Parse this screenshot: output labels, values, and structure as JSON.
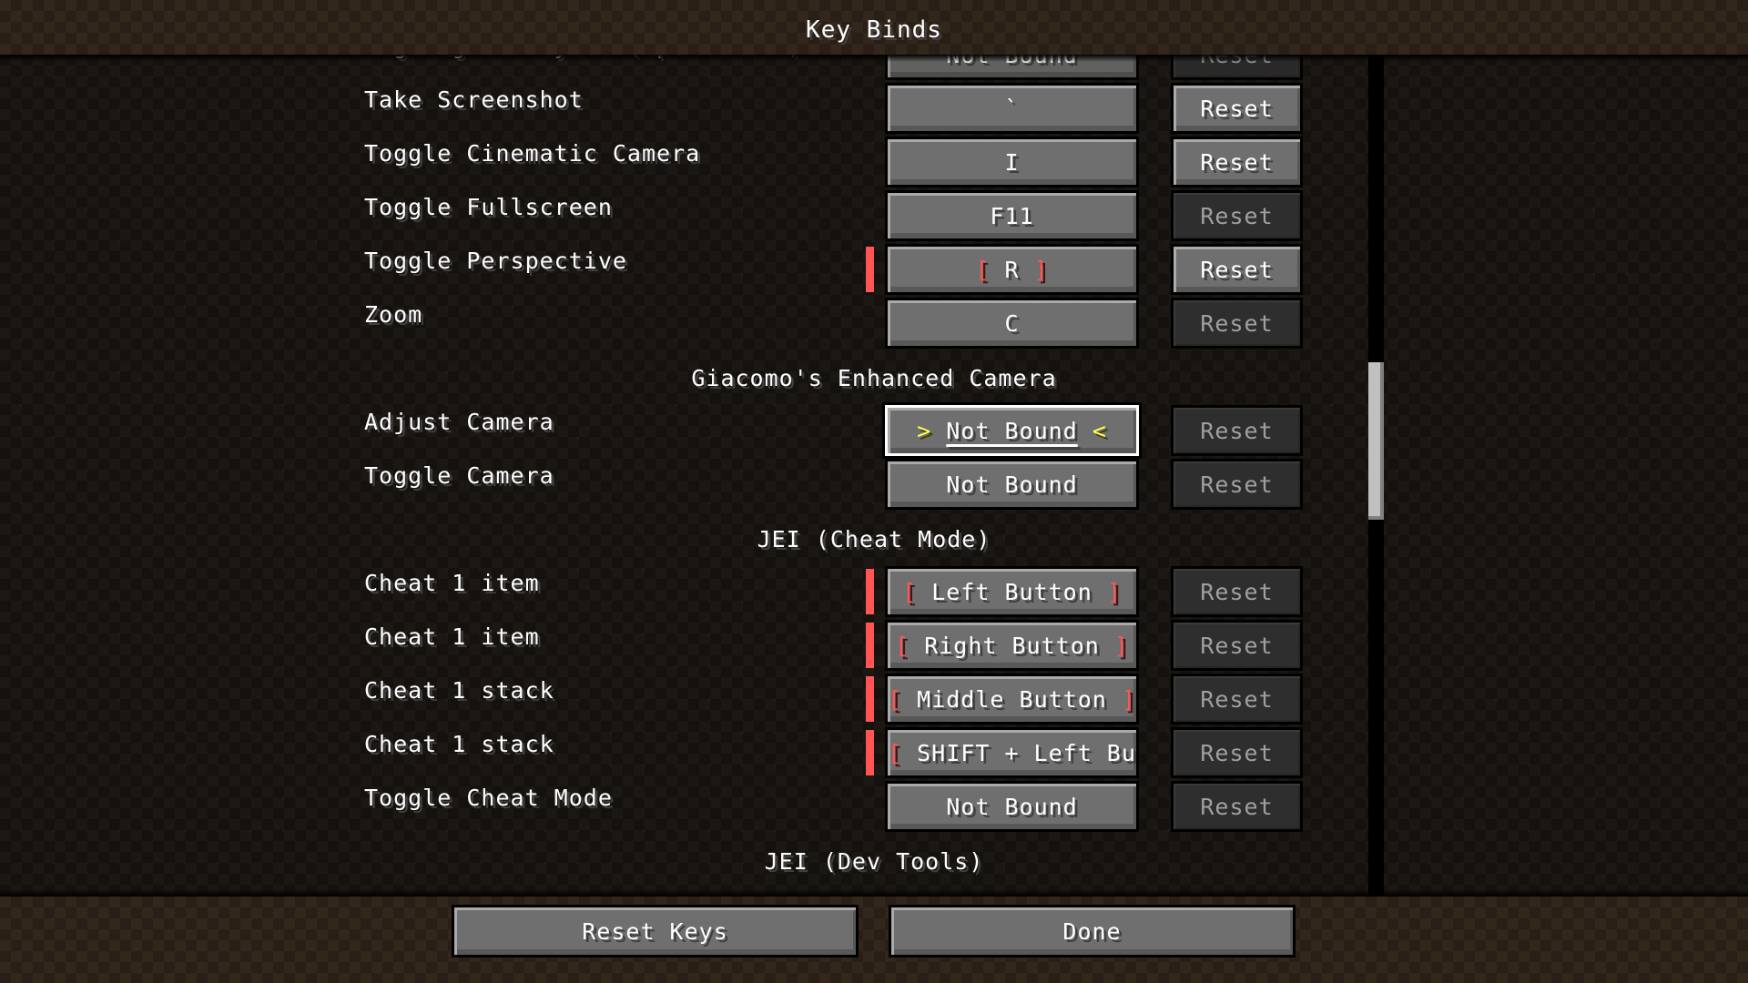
{
  "header": {
    "title": "Key Binds"
  },
  "list": {
    "rows": [
      {
        "type": "bind",
        "label": "Highlight Players (Spectators)",
        "key": "Not Bound",
        "reset": "Reset",
        "reset_enabled": false,
        "conflict": false,
        "focused": false
      },
      {
        "type": "bind",
        "label": "Take Screenshot",
        "key": "`",
        "reset": "Reset",
        "reset_enabled": true,
        "conflict": false,
        "focused": false
      },
      {
        "type": "bind",
        "label": "Toggle Cinematic Camera",
        "key": "I",
        "reset": "Reset",
        "reset_enabled": true,
        "conflict": false,
        "focused": false
      },
      {
        "type": "bind",
        "label": "Toggle Fullscreen",
        "key": "F11",
        "reset": "Reset",
        "reset_enabled": false,
        "conflict": false,
        "focused": false
      },
      {
        "type": "bind",
        "label": "Toggle Perspective",
        "key": "R",
        "reset": "Reset",
        "reset_enabled": true,
        "conflict": true,
        "focused": false
      },
      {
        "type": "bind",
        "label": "Zoom",
        "key": "C",
        "reset": "Reset",
        "reset_enabled": false,
        "conflict": false,
        "focused": false
      },
      {
        "type": "section",
        "label": "Giacomo's Enhanced Camera"
      },
      {
        "type": "bind",
        "label": "Adjust Camera",
        "key": "Not Bound",
        "reset": "Reset",
        "reset_enabled": false,
        "conflict": false,
        "focused": true
      },
      {
        "type": "bind",
        "label": "Toggle Camera",
        "key": "Not Bound",
        "reset": "Reset",
        "reset_enabled": false,
        "conflict": false,
        "focused": false
      },
      {
        "type": "section",
        "label": "JEI (Cheat Mode)"
      },
      {
        "type": "bind",
        "label": "Cheat 1 item",
        "key": "Left Button",
        "reset": "Reset",
        "reset_enabled": false,
        "conflict": true,
        "focused": false
      },
      {
        "type": "bind",
        "label": "Cheat 1 item",
        "key": "Right Button",
        "reset": "Reset",
        "reset_enabled": false,
        "conflict": true,
        "focused": false
      },
      {
        "type": "bind",
        "label": "Cheat 1 stack",
        "key": "Middle Button",
        "reset": "Reset",
        "reset_enabled": false,
        "conflict": true,
        "focused": false
      },
      {
        "type": "bind",
        "label": "Cheat 1 stack",
        "key": "SHIFT + Left But",
        "reset": "Reset",
        "reset_enabled": false,
        "conflict": true,
        "focused": false
      },
      {
        "type": "bind",
        "label": "Toggle Cheat Mode",
        "key": "Not Bound",
        "reset": "Reset",
        "reset_enabled": false,
        "conflict": false,
        "focused": false
      },
      {
        "type": "section",
        "label": "JEI (Dev Tools)"
      }
    ],
    "conflict_brackets": {
      "open": "[",
      "close": "]"
    },
    "focus_arrows": {
      "left": ">",
      "right": "<"
    },
    "scroll_position": 0.45
  },
  "footer": {
    "reset_keys_label": "Reset Keys",
    "done_label": "Done"
  },
  "colors": {
    "conflict": "#ff5555",
    "focus_arrow": "#ffff55",
    "text": "#ffffff",
    "disabled_text": "#a0a0a0"
  }
}
